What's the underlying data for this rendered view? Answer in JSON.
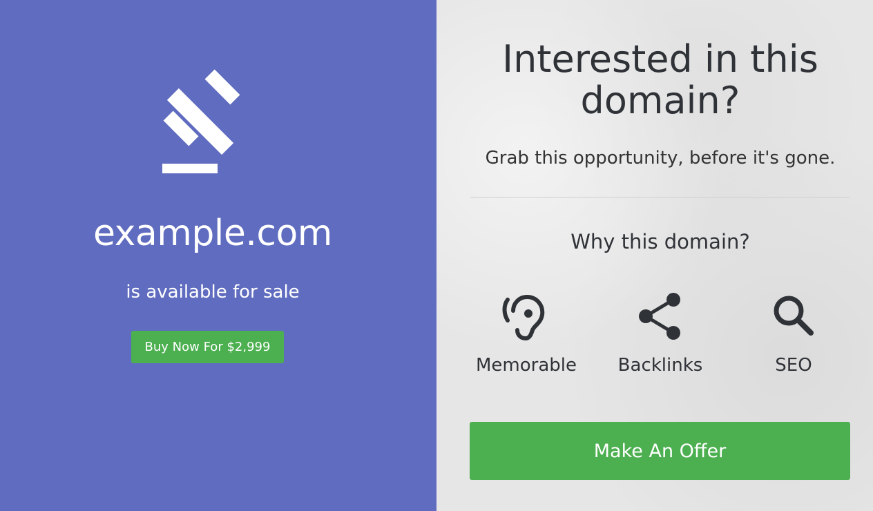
{
  "left_panel": {
    "background_color": "#5f6cbf",
    "logo_icon": "gavel-icon",
    "domain_name": "example.com",
    "availability_text": "is available for sale",
    "buy_button_label": "Buy Now For $2,999"
  },
  "right_panel": {
    "headline": "Interested in this domain?",
    "subheadline": "Grab this opportunity, before it's gone.",
    "why_title": "Why this domain?",
    "features": [
      {
        "icon": "ear-icon",
        "label": "Memorable"
      },
      {
        "icon": "share-icon",
        "label": "Backlinks"
      },
      {
        "icon": "search-icon",
        "label": "SEO"
      }
    ],
    "offer_button_label": "Make An Offer"
  },
  "colors": {
    "accent_green": "#4caf50",
    "left_bg": "#5f6cbf",
    "right_bg": "#e6e6e6",
    "dark_text": "#2f3237"
  }
}
